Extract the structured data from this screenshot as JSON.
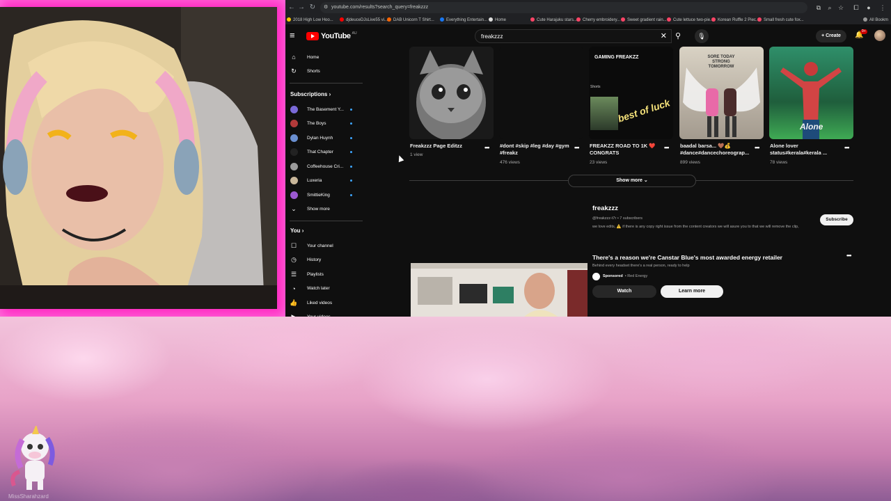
{
  "browser": {
    "url": "youtube.com/results?search_query=freakzzz",
    "bookmarks": [
      {
        "label": "2018 High Low Hoo...",
        "color": "#ffcc00"
      },
      {
        "label": "djdeuceDJsLive55 vi...",
        "color": "#ff0000"
      },
      {
        "label": "DAB Unicorn T Shirt...",
        "color": "#ff6600"
      },
      {
        "label": "Everything Entertain...",
        "color": "#1877f2"
      },
      {
        "label": "Home",
        "color": "#dddddd"
      },
      {
        "label": "Cute Harajuku stars...",
        "color": "#ff4466"
      },
      {
        "label": "Cherry embroidery...",
        "color": "#ff4466"
      },
      {
        "label": "Sweet gradient rain...",
        "color": "#ff4466"
      },
      {
        "label": "Cute lettuce two-pie...",
        "color": "#ff4466"
      },
      {
        "label": "Korean Ruffle 2 Piec...",
        "color": "#ff4466"
      },
      {
        "label": "Small fresh cute fox...",
        "color": "#ff4466"
      },
      {
        "label": "All Bookm",
        "color": "#999999"
      }
    ]
  },
  "masthead": {
    "logo_word": "YouTube",
    "logo_region": "AU",
    "search_value": "freakzzz",
    "create_label": "Create",
    "notification_count": "9+"
  },
  "sidebar": {
    "top_items": [
      {
        "label": "Home",
        "icon": "home-icon",
        "glyph": "⌂"
      },
      {
        "label": "Shorts",
        "icon": "shorts-icon",
        "glyph": "↻"
      }
    ],
    "subscriptions_heading": "Subscriptions",
    "subscriptions": [
      {
        "label": "The Basement Y...",
        "color": "#7a6ad8"
      },
      {
        "label": "The Boys",
        "color": "#b23a3a"
      },
      {
        "label": "Dylan Huynh",
        "color": "#6a8fd0"
      },
      {
        "label": "That Chapter",
        "color": "#222222"
      },
      {
        "label": "Coffeehouse Cri...",
        "color": "#9a9a9a"
      },
      {
        "label": "Luxeria",
        "color": "#c9b79a"
      },
      {
        "label": "SmittieKing",
        "color": "#9b59d0"
      }
    ],
    "show_more_label": "Show more",
    "you_heading": "You",
    "you_items": [
      {
        "label": "Your channel",
        "icon": "your-channel-icon",
        "glyph": "☐"
      },
      {
        "label": "History",
        "icon": "history-icon",
        "glyph": "◷"
      },
      {
        "label": "Playlists",
        "icon": "playlists-icon",
        "glyph": "☰"
      },
      {
        "label": "Watch later",
        "icon": "watch-later-icon",
        "glyph": "◔"
      },
      {
        "label": "Liked videos",
        "icon": "liked-videos-icon",
        "glyph": "👍"
      },
      {
        "label": "Your videos",
        "icon": "your-videos-icon",
        "glyph": "▶"
      }
    ]
  },
  "results": {
    "videos": [
      {
        "title": "Freakzzz Page Editzz",
        "views": "1 view",
        "thumb_text": ""
      },
      {
        "title": "#dont #skip #leg #day #gym #freakz",
        "views": "476 views",
        "thumb_text": ""
      },
      {
        "title": "FREAKZZ ROAD TO 1K ❤️ CONGRATS",
        "views": "23 views",
        "thumb_text": "GAMING FREAKZZ",
        "thumb_badge": "Shorts",
        "thumb_overlay": "best of luck"
      },
      {
        "title": "baadal barsa... 🤎💰 #dance#dancechoreograp...",
        "views": "899 views",
        "thumb_text": "SORE TODAY STRONG TOMORROW"
      },
      {
        "title": "Alone lover status#kerala#kerala ...",
        "views": "78 views",
        "thumb_text": "Alone"
      }
    ],
    "show_more_label": "Show more",
    "channel": {
      "name": "freakzzz",
      "handle_subs": "@freakzzz-t7r • 7 subscribers",
      "description": "we love edits, ⚠️ if there is any copy right issue from the content creators we will asure you to that we will remove the clip,",
      "subscribe_label": "Subscribe"
    },
    "ad": {
      "title": "There's a reason we're Canstar Blue's most awarded energy retailer",
      "subtitle": "Behind every headset there's a real person, ready to help",
      "sponsored_label": "Sponsored",
      "advertiser": "• Red Energy",
      "watch_label": "Watch",
      "learn_more_label": "Learn more"
    }
  },
  "overlay": {
    "streamer_name": "MissSharahzard"
  }
}
